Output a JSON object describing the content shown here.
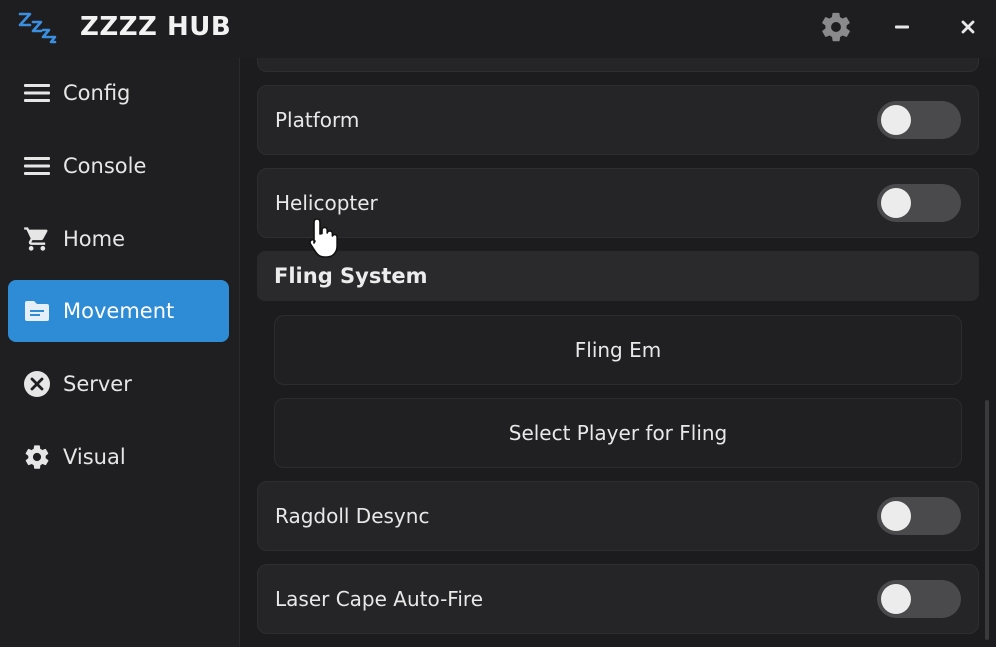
{
  "app": {
    "title": "ZZZZ HUB",
    "logo_icon": "zzz-logo"
  },
  "titlebar": {
    "settings_icon": "gear-icon",
    "minimize_glyph": "–",
    "close_glyph": "×"
  },
  "sidebar": {
    "items": [
      {
        "label": "Config",
        "icon": "menu-icon",
        "active": false
      },
      {
        "label": "Console",
        "icon": "menu-icon",
        "active": false
      },
      {
        "label": "Home",
        "icon": "cart-icon",
        "active": false
      },
      {
        "label": "Movement",
        "icon": "folder-icon",
        "active": true
      },
      {
        "label": "Server",
        "icon": "close-circle-icon",
        "active": false
      },
      {
        "label": "Visual",
        "icon": "gear-icon",
        "active": false
      }
    ]
  },
  "content": {
    "toggles_top": [
      {
        "label": "Platform",
        "on": false
      },
      {
        "label": "Helicopter",
        "on": false
      }
    ],
    "section_title": "Fling System",
    "buttons": [
      {
        "label": "Fling Em"
      },
      {
        "label": "Select Player for Fling"
      }
    ],
    "toggles_bottom": [
      {
        "label": "Ragdoll Desync",
        "on": false
      },
      {
        "label": "Laser Cape Auto-Fire",
        "on": false
      }
    ]
  },
  "colors": {
    "accent": "#2e8bd6",
    "background": "#1c1c1e",
    "card": "#252527",
    "toggle_off": "#4a4a4d"
  }
}
